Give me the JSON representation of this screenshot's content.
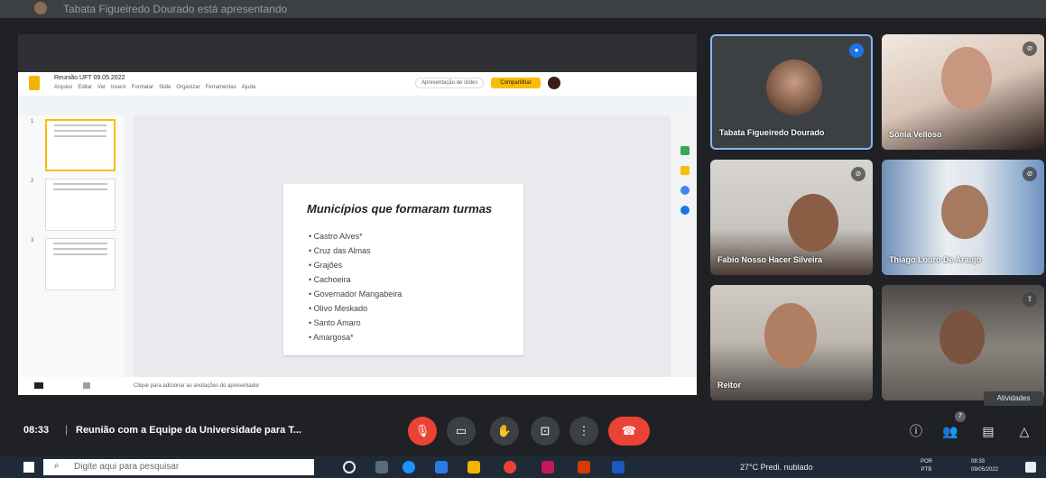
{
  "window": {
    "title": "Tabata Figueiredo Dourado está apresentando"
  },
  "slides_app": {
    "doc_title": "Reunião UFT 09.05.2022",
    "menu": [
      "Arquivo",
      "Editar",
      "Ver",
      "Inserir",
      "Formatar",
      "Slide",
      "Organizar",
      "Ferramentas",
      "Ajuda"
    ],
    "present_label": "Apresentação de slides",
    "share_label": "Compartilhar",
    "notes_placeholder": "Clique para adicionar as anotações do apresentador",
    "thumb_numbers": [
      "1",
      "2",
      "3"
    ]
  },
  "slide": {
    "title": "Municípios que formaram turmas",
    "items": [
      "Castro Alves*",
      "Cruz das Almas",
      "Grajões",
      "Cachoeira",
      "Governador Mangabeira",
      "Olivo Meskado",
      "Santo Amaro",
      "Amargosa*"
    ]
  },
  "participants": [
    {
      "name": "Tabata Figueiredo Dourado",
      "speaking": true
    },
    {
      "name": "Sônia Velloso"
    },
    {
      "name": "Fabio Nosso Hacer Silveira"
    },
    {
      "name": "Thiago Louro De Araujo"
    },
    {
      "name": "Reitor"
    },
    {
      "name": ""
    }
  ],
  "meeting": {
    "time": "08:33",
    "separator": "|",
    "title": "Reunião com a Equipe da Universidade para T...",
    "activities_label": "Atividades",
    "people_count": "7"
  },
  "taskbar": {
    "search_placeholder": "Digite aqui para pesquisar",
    "weather": "27°C Predi. nublado",
    "lang": "POR",
    "lang2": "PTB",
    "time": "08:33",
    "date": "09/05/2022"
  },
  "colors": {
    "meet_bg": "#202124",
    "active_border": "#8ab4f8",
    "hangup": "#ea4335",
    "slides_yellow": "#fbbc04"
  }
}
